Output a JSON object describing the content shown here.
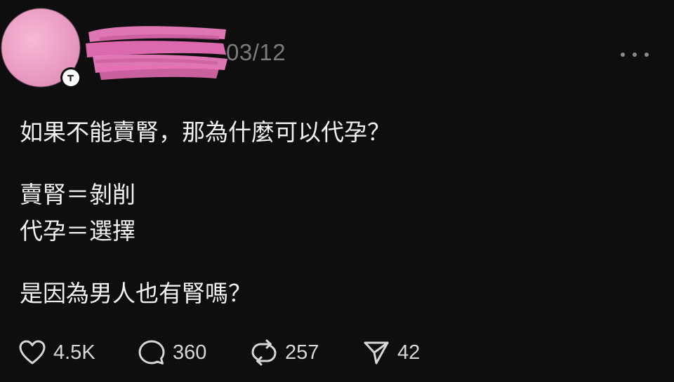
{
  "post": {
    "timestamp": "03/12",
    "avatar_color": "#ea9bc3",
    "redaction_color": "#f07fc2",
    "body_lines": [
      "如果不能賣腎，那為什麼可以代孕？",
      "賣腎＝剝削",
      "代孕＝選擇",
      "是因為男人也有腎嗎？"
    ],
    "actions": {
      "like": {
        "icon": "heart-icon",
        "count": "4.5K"
      },
      "reply": {
        "icon": "comment-icon",
        "count": "360"
      },
      "repost": {
        "icon": "repost-icon",
        "count": "257"
      },
      "share": {
        "icon": "send-icon",
        "count": "42"
      }
    }
  },
  "colors": {
    "background": "#0e0e0f",
    "text": "#f2f2f2",
    "muted": "#7b7b7f",
    "icon": "#d7d7d9"
  }
}
